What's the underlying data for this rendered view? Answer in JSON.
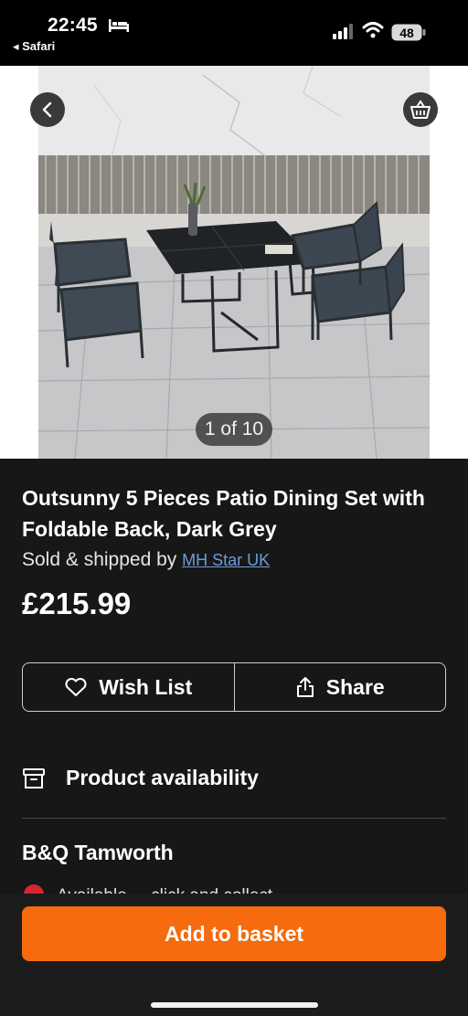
{
  "status_bar": {
    "time": "22:45",
    "back_app": "◂ Safari",
    "battery": "48",
    "icons": [
      "bed-icon",
      "signal-icon",
      "wifi-icon",
      "battery-icon"
    ]
  },
  "gallery": {
    "counter": "1 of 10",
    "icons": [
      "chevron-left-icon",
      "basket-icon"
    ]
  },
  "product": {
    "title": "Outsunny 5 Pieces Patio Dining Set with Foldable Back, Dark Grey",
    "sold_prefix": "Sold & shipped by ",
    "seller": "MH Star UK",
    "price": "£215.99"
  },
  "actions": {
    "wishlist_label": "Wish List",
    "share_label": "Share",
    "icons": [
      "heart-icon",
      "share-icon"
    ]
  },
  "availability": {
    "label": "Product availability",
    "icon": "archive-box-icon",
    "store": "B&Q Tamworth",
    "partial_text": "Available ... click and collect ..."
  },
  "basket": {
    "button_label": "Add to basket"
  },
  "colors": {
    "background": "#171717",
    "accent": "#f56b0d",
    "link": "#6f9bd9"
  }
}
